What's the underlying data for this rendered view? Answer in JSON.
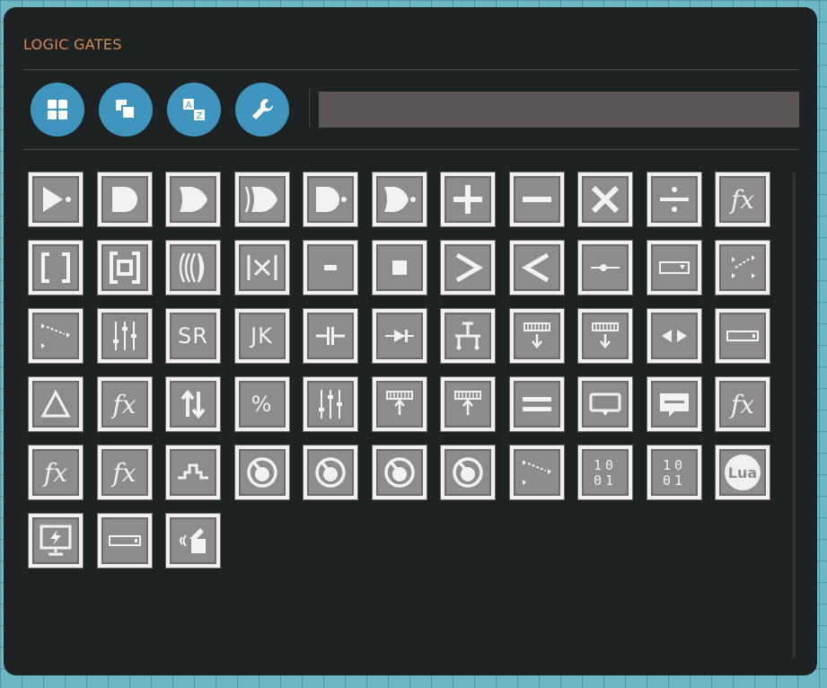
{
  "panel": {
    "title": "LOGIC GATES"
  },
  "toolbar": {
    "buttons": [
      {
        "name": "grid-view-button",
        "icon": "grid-icon"
      },
      {
        "name": "copy-button",
        "icon": "copy-icon"
      },
      {
        "name": "sort-az-button",
        "icon": "sort-az-icon"
      },
      {
        "name": "settings-button",
        "icon": "wrench-icon"
      }
    ],
    "sort_letter_a": "A",
    "sort_letter_z": "Z"
  },
  "search": {
    "value": "",
    "placeholder": ""
  },
  "components": [
    {
      "name": "buffer-gate",
      "icon": "buffer"
    },
    {
      "name": "and-gate",
      "icon": "and"
    },
    {
      "name": "or-gate",
      "icon": "or"
    },
    {
      "name": "xor-gate",
      "icon": "xor"
    },
    {
      "name": "nand-gate",
      "icon": "nand"
    },
    {
      "name": "nor-gate",
      "icon": "nor"
    },
    {
      "name": "add",
      "icon": "plus"
    },
    {
      "name": "subtract",
      "icon": "minus"
    },
    {
      "name": "multiply",
      "icon": "times"
    },
    {
      "name": "divide",
      "icon": "divide"
    },
    {
      "name": "function",
      "icon": "fx",
      "label": "fx"
    },
    {
      "name": "bracket",
      "icon": "bracket"
    },
    {
      "name": "nested-bracket",
      "icon": "nested-bracket"
    },
    {
      "name": "multi-lens",
      "icon": "multi-lens"
    },
    {
      "name": "abs-multiply",
      "icon": "abs-x"
    },
    {
      "name": "negate",
      "icon": "small-dash"
    },
    {
      "name": "constant",
      "icon": "small-square"
    },
    {
      "name": "greater-than",
      "icon": "gt"
    },
    {
      "name": "less-than",
      "icon": "lt"
    },
    {
      "name": "slider",
      "icon": "slider"
    },
    {
      "name": "dropdown",
      "icon": "dropdown"
    },
    {
      "name": "switchbox",
      "icon": "switchbox"
    },
    {
      "name": "switchbox-2",
      "icon": "switchbox2"
    },
    {
      "name": "mixer",
      "icon": "mixer"
    },
    {
      "name": "sr-latch",
      "icon": "text",
      "label": "SR"
    },
    {
      "name": "jk-flip-flop",
      "icon": "text",
      "label": "JK"
    },
    {
      "name": "capacitor",
      "icon": "capacitor"
    },
    {
      "name": "diode",
      "icon": "diode"
    },
    {
      "name": "pipe-junction",
      "icon": "junction"
    },
    {
      "name": "composite-read",
      "icon": "comp-read"
    },
    {
      "name": "composite-read-2",
      "icon": "comp-read"
    },
    {
      "name": "left-right",
      "icon": "leftright"
    },
    {
      "name": "display-bar",
      "icon": "bar"
    },
    {
      "name": "delta",
      "icon": "delta"
    },
    {
      "name": "function-2",
      "icon": "fx",
      "label": "fx"
    },
    {
      "name": "up-down",
      "icon": "updown"
    },
    {
      "name": "modulo",
      "icon": "text",
      "label": "%"
    },
    {
      "name": "mixer-2",
      "icon": "mixer"
    },
    {
      "name": "composite-write",
      "icon": "comp-write"
    },
    {
      "name": "composite-write-2",
      "icon": "comp-write"
    },
    {
      "name": "equal",
      "icon": "equal"
    },
    {
      "name": "text-box",
      "icon": "textbox"
    },
    {
      "name": "speech-bubble",
      "icon": "bubble"
    },
    {
      "name": "function-3",
      "icon": "fx",
      "label": "fx"
    },
    {
      "name": "function-4",
      "icon": "fx",
      "label": "fx"
    },
    {
      "name": "function-5",
      "icon": "fx",
      "label": "fx"
    },
    {
      "name": "pulse",
      "icon": "pulse"
    },
    {
      "name": "timer-1",
      "icon": "timer"
    },
    {
      "name": "timer-2",
      "icon": "timer"
    },
    {
      "name": "timer-3",
      "icon": "timer"
    },
    {
      "name": "timer-4",
      "icon": "timer"
    },
    {
      "name": "switchbox-3",
      "icon": "switchbox2"
    },
    {
      "name": "binary-1",
      "icon": "binary",
      "label": "10|01"
    },
    {
      "name": "binary-2",
      "icon": "binary",
      "label": "10|01"
    },
    {
      "name": "lua-script",
      "icon": "lua",
      "label": "Lua"
    },
    {
      "name": "monitor",
      "icon": "monitor"
    },
    {
      "name": "display-bar-2",
      "icon": "bar"
    },
    {
      "name": "battery-tool",
      "icon": "batt"
    }
  ]
}
